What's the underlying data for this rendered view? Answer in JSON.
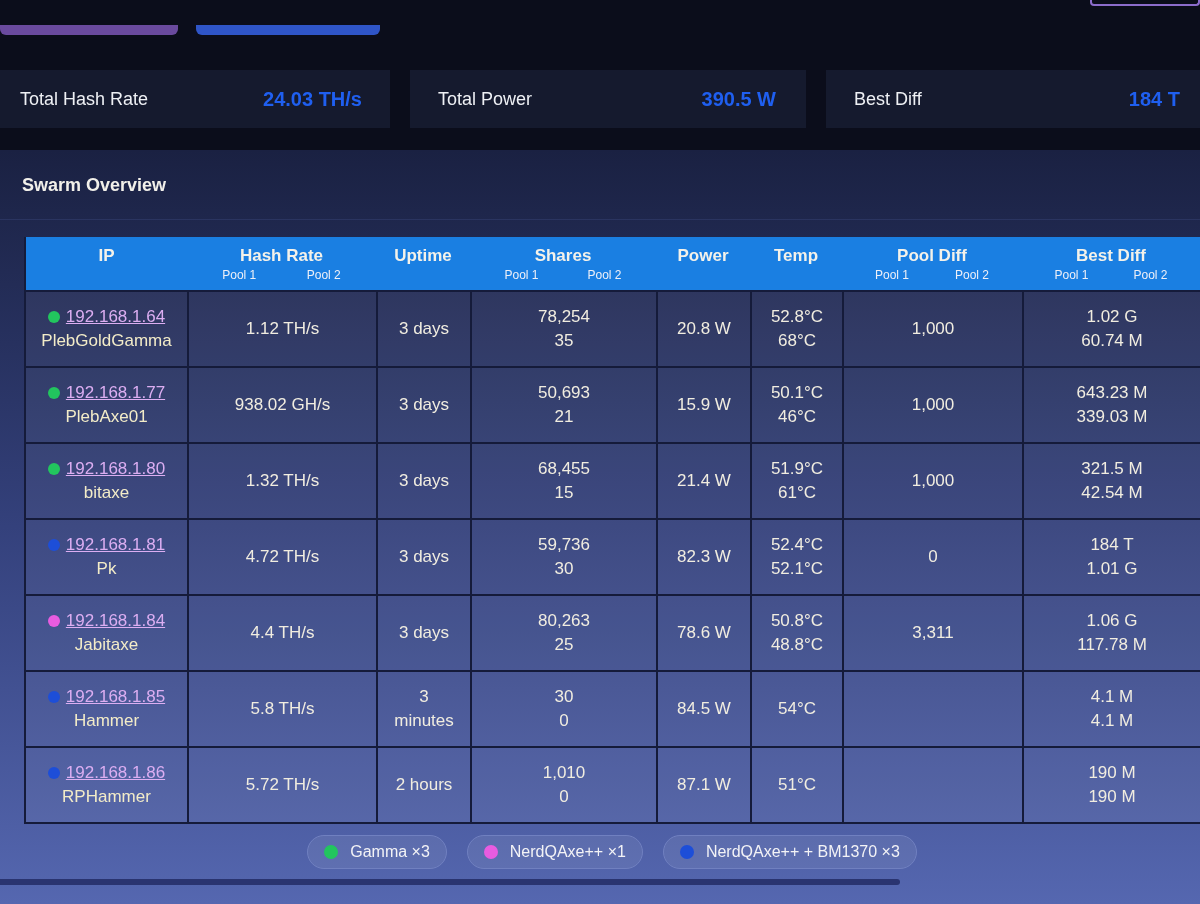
{
  "stats": [
    {
      "label": "Total Hash Rate",
      "value": "24.03 TH/s"
    },
    {
      "label": "Total Power",
      "value": "390.5 W"
    },
    {
      "label": "Best Diff",
      "value": "184 T"
    }
  ],
  "panel": {
    "title": "Swarm Overview"
  },
  "table": {
    "columns": [
      {
        "label": "IP"
      },
      {
        "label": "Hash Rate",
        "sublabels": [
          "Pool 1",
          "Pool 2"
        ]
      },
      {
        "label": "Uptime"
      },
      {
        "label": "Shares",
        "sublabels": [
          "Pool 1",
          "Pool 2"
        ]
      },
      {
        "label": "Power"
      },
      {
        "label": "Temp"
      },
      {
        "label": "Pool Diff",
        "sublabels": [
          "Pool 1",
          "Pool 2"
        ]
      },
      {
        "label": "Best Diff",
        "sublabels": [
          "Pool 1",
          "Pool 2"
        ]
      }
    ],
    "rows": [
      {
        "ip": "192.168.1.64",
        "name": "PlebGoldGamma",
        "color": "#22c55e",
        "hash_rate": "1.12 TH/s",
        "uptime": "3 days",
        "shares": [
          "78,254",
          "35"
        ],
        "power": "20.8 W",
        "temp": [
          "52.8°C",
          "68°C"
        ],
        "pool_diff": "1,000",
        "best_diff": [
          "1.02 G",
          "60.74 M"
        ]
      },
      {
        "ip": "192.168.1.77",
        "name": "PlebAxe01",
        "color": "#22c55e",
        "hash_rate": "938.02 GH/s",
        "uptime": "3 days",
        "shares": [
          "50,693",
          "21"
        ],
        "power": "15.9 W",
        "temp": [
          "50.1°C",
          "46°C"
        ],
        "pool_diff": "1,000",
        "best_diff": [
          "643.23 M",
          "339.03 M"
        ]
      },
      {
        "ip": "192.168.1.80",
        "name": "bitaxe",
        "color": "#22c55e",
        "hash_rate": "1.32 TH/s",
        "uptime": "3 days",
        "shares": [
          "68,455",
          "15"
        ],
        "power": "21.4 W",
        "temp": [
          "51.9°C",
          "61°C"
        ],
        "pool_diff": "1,000",
        "best_diff": [
          "321.5 M",
          "42.54 M"
        ]
      },
      {
        "ip": "192.168.1.81",
        "name": "Pk",
        "color": "#1d4ed8",
        "hash_rate": "4.72 TH/s",
        "uptime": "3 days",
        "shares": [
          "59,736",
          "30"
        ],
        "power": "82.3 W",
        "temp": [
          "52.4°C",
          "52.1°C"
        ],
        "pool_diff": "0",
        "best_diff": [
          "184 T",
          "1.01 G"
        ]
      },
      {
        "ip": "192.168.1.84",
        "name": "Jabitaxe",
        "color": "#e85ce0",
        "hash_rate": "4.4 TH/s",
        "uptime": "3 days",
        "shares": [
          "80,263",
          "25"
        ],
        "power": "78.6 W",
        "temp": [
          "50.8°C",
          "48.8°C"
        ],
        "pool_diff": "3,311",
        "best_diff": [
          "1.06 G",
          "117.78 M"
        ]
      },
      {
        "ip": "192.168.1.85",
        "name": "Hammer",
        "color": "#1d4ed8",
        "hash_rate": "5.8 TH/s",
        "uptime": "3 minutes",
        "shares": [
          "30",
          "0"
        ],
        "power": "84.5 W",
        "temp": [
          "54°C"
        ],
        "best_diff": [
          "4.1 M",
          "4.1 M"
        ]
      },
      {
        "ip": "192.168.1.86",
        "name": "RPHammer",
        "color": "#1d4ed8",
        "hash_rate": "5.72 TH/s",
        "uptime": "2 hours",
        "shares": [
          "1,010",
          "0"
        ],
        "power": "87.1 W",
        "temp": [
          "51°C"
        ],
        "best_diff": [
          "190 M",
          "190 M"
        ]
      }
    ]
  },
  "legend": [
    {
      "label": "Gamma ×3",
      "color": "#22c55e"
    },
    {
      "label": "NerdQAxe++ ×1",
      "color": "#e85ce0"
    },
    {
      "label": "NerdQAxe++ + BM1370 ×3",
      "color": "#1d4ed8"
    }
  ]
}
